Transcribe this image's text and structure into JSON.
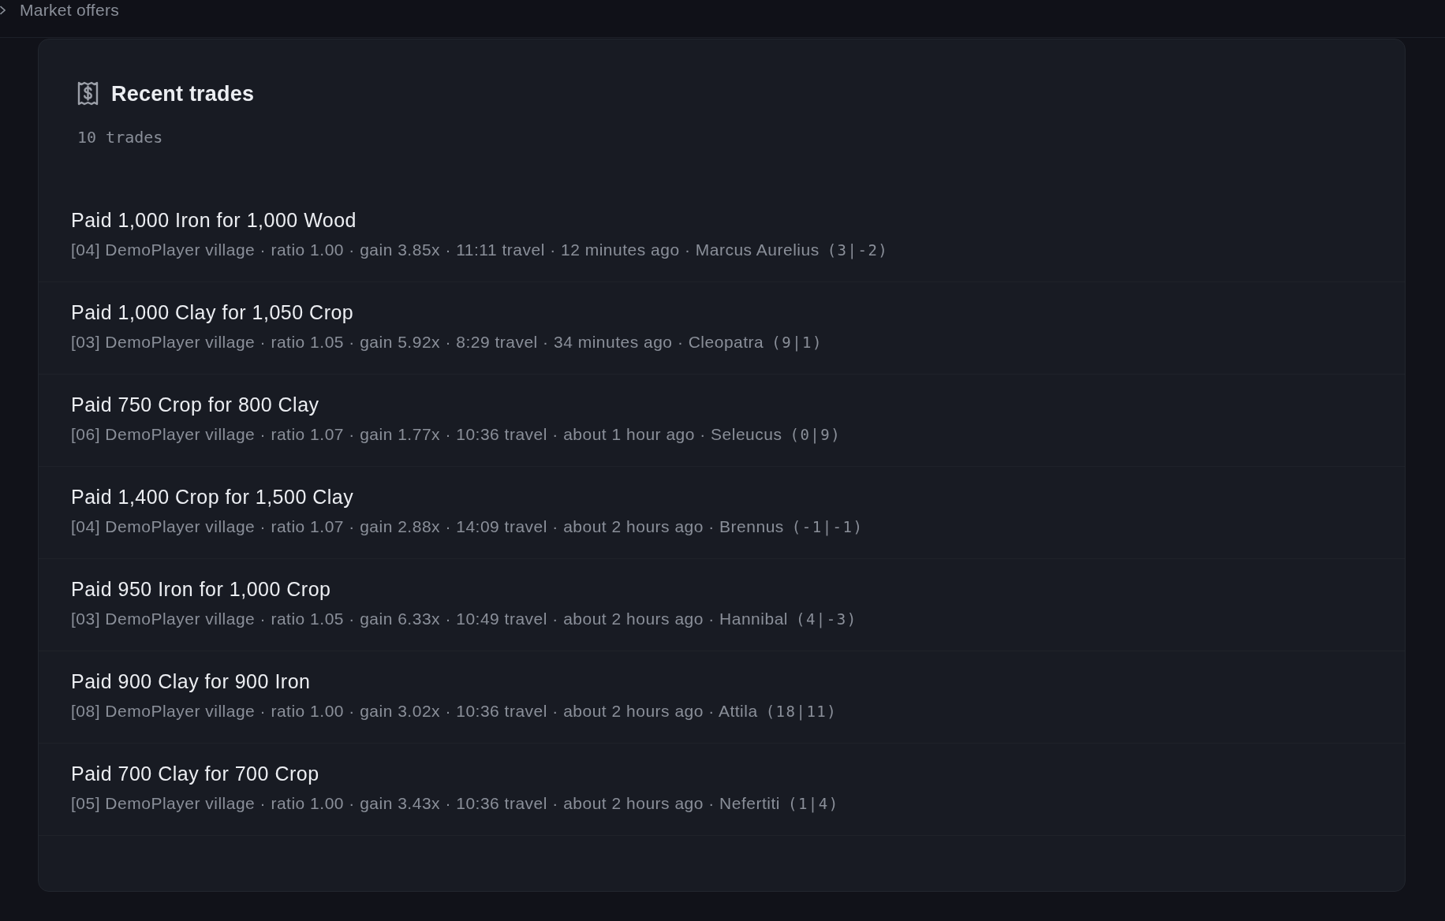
{
  "section_toggle": {
    "label": "Market offers",
    "expanded": false
  },
  "panel": {
    "title": "Recent trades",
    "count": "10 trades"
  },
  "trades": [
    {
      "title": "Paid 1,000 Iron for 1,000 Wood",
      "details": "[04] DemoPlayer village · ratio 1.00 · gain 3.85x · 11:11 travel · 12 minutes ago · Marcus Aurelius",
      "coords": "(3|-2)"
    },
    {
      "title": "Paid 1,000 Clay for 1,050 Crop",
      "details": "[03] DemoPlayer village · ratio 1.05 · gain 5.92x · 8:29 travel · 34 minutes ago · Cleopatra",
      "coords": "(9|1)"
    },
    {
      "title": "Paid 750 Crop for 800 Clay",
      "details": "[06] DemoPlayer village · ratio 1.07 · gain 1.77x · 10:36 travel · about 1 hour ago · Seleucus",
      "coords": "(0|9)"
    },
    {
      "title": "Paid 1,400 Crop for 1,500 Clay",
      "details": "[04] DemoPlayer village · ratio 1.07 · gain 2.88x · 14:09 travel · about 2 hours ago · Brennus",
      "coords": "(-1|-1)"
    },
    {
      "title": "Paid 950 Iron for 1,000 Crop",
      "details": "[03] DemoPlayer village · ratio 1.05 · gain 6.33x · 10:49 travel · about 2 hours ago · Hannibal",
      "coords": "(4|-3)"
    },
    {
      "title": "Paid 900 Clay for 900 Iron",
      "details": "[08] DemoPlayer village · ratio 1.00 · gain 3.02x · 10:36 travel · about 2 hours ago · Attila",
      "coords": "(18|11)"
    },
    {
      "title": "Paid 700 Clay for 700 Crop",
      "details": "[05] DemoPlayer village · ratio 1.00 · gain 3.43x · 10:36 travel · about 2 hours ago · Nefertiti",
      "coords": "(1|4)"
    }
  ]
}
